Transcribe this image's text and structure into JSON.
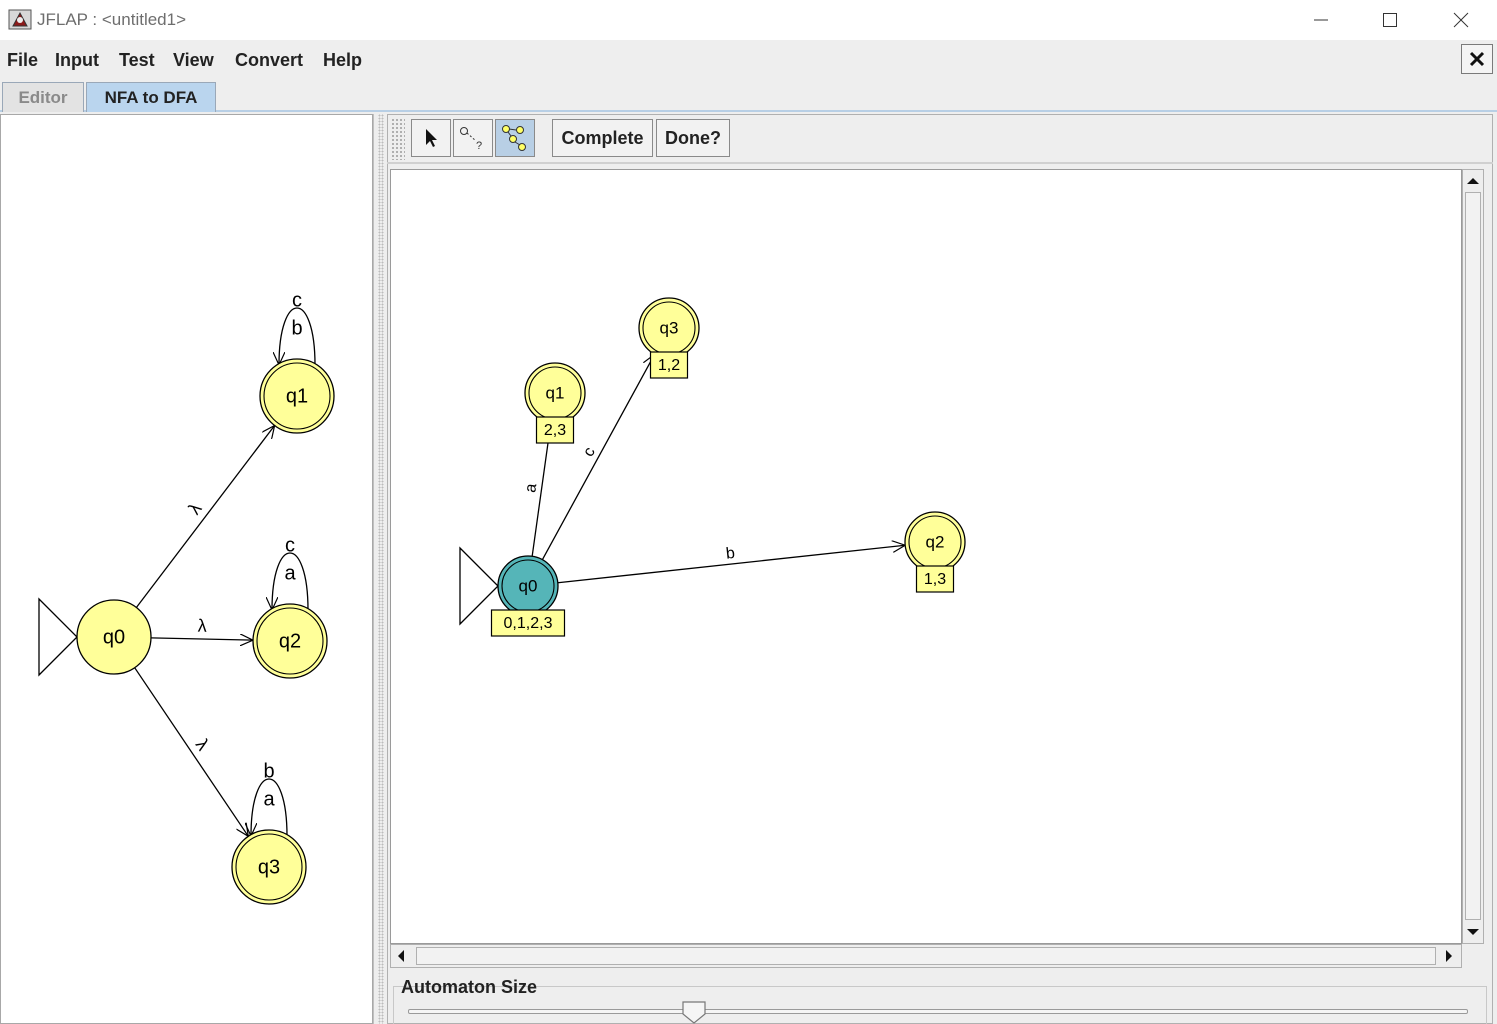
{
  "window": {
    "title": "JFLAP : <untitled1>"
  },
  "menu": [
    "File",
    "Input",
    "Test",
    "View",
    "Convert",
    "Help"
  ],
  "tabs": [
    "Editor",
    "NFA to DFA"
  ],
  "toolbar": {
    "complete_label": "Complete",
    "done_label": "Done?"
  },
  "slider": {
    "label": "Automaton Size",
    "value_fraction": 0.27
  },
  "nfa": {
    "states": [
      "q0",
      "q1",
      "q2",
      "q3"
    ],
    "initial": "q0",
    "final": [
      "q1",
      "q2",
      "q3"
    ],
    "transitions": [
      {
        "from": "q0",
        "to": "q1",
        "label": "λ"
      },
      {
        "from": "q0",
        "to": "q2",
        "label": "λ"
      },
      {
        "from": "q0",
        "to": "q3",
        "label": "λ"
      },
      {
        "from": "q1",
        "to": "q1",
        "labels": [
          "c",
          "b"
        ]
      },
      {
        "from": "q2",
        "to": "q2",
        "labels": [
          "c",
          "a"
        ]
      },
      {
        "from": "q3",
        "to": "q3",
        "labels": [
          "b",
          "a"
        ]
      }
    ]
  },
  "dfa": {
    "states": [
      {
        "name": "q0",
        "set": "0,1,2,3",
        "initial": true,
        "final": true,
        "selected": true
      },
      {
        "name": "q1",
        "set": "2,3",
        "final": true
      },
      {
        "name": "q2",
        "set": "1,3",
        "final": true
      },
      {
        "name": "q3",
        "set": "1,2",
        "final": true
      }
    ],
    "transitions": [
      {
        "from": "q0",
        "to": "q1",
        "label": "a"
      },
      {
        "from": "q0",
        "to": "q3",
        "label": "c"
      },
      {
        "from": "q0",
        "to": "q2",
        "label": "b"
      }
    ]
  },
  "colors": {
    "state_fill": "#ffff99",
    "selected_state_fill": "#55b5b8",
    "tab_selected": "#bad5ee"
  }
}
